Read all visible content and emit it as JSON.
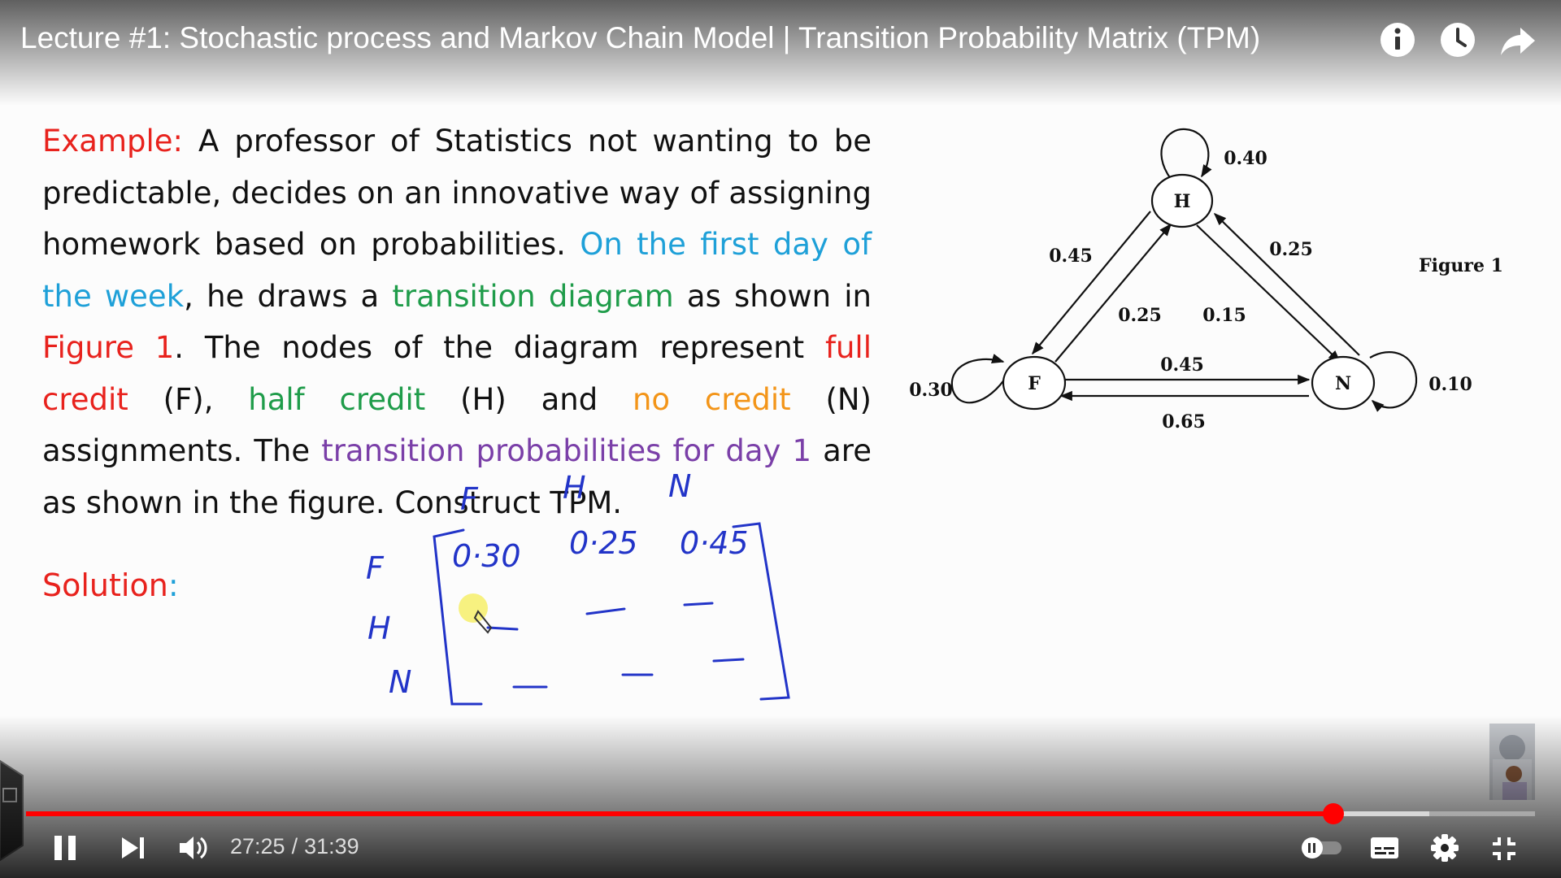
{
  "video": {
    "title": "Lecture #1: Stochastic process and Markov Chain Model | Transition Probability Matrix (TPM)"
  },
  "top_icons": [
    "info-icon",
    "clock-icon",
    "share-icon"
  ],
  "slide": {
    "paragraph": [
      {
        "text": "Example:",
        "color": "red"
      },
      {
        "text": " A professor of Statistics not wanting to be predictable, decides on an innovative way of assigning homework based on probabilities. ",
        "color": "black"
      },
      {
        "text": "On the first day of the week",
        "color": "blue"
      },
      {
        "text": ", he draws a ",
        "color": "black"
      },
      {
        "text": "transition diagram",
        "color": "green"
      },
      {
        "text": " as shown in ",
        "color": "black"
      },
      {
        "text": "Figure 1",
        "color": "red"
      },
      {
        "text": ". The nodes of the diagram represent ",
        "color": "black"
      },
      {
        "text": "full credit",
        "color": "red"
      },
      {
        "text": " (F), ",
        "color": "black"
      },
      {
        "text": "half credit",
        "color": "green"
      },
      {
        "text": " (H) and ",
        "color": "black"
      },
      {
        "text": "no credit",
        "color": "orange"
      },
      {
        "text": " (N) assignments. The ",
        "color": "black"
      },
      {
        "text": "transition probabilities for day 1",
        "color": "purple"
      },
      {
        "text": " are as shown in the figure. Construct TPM.",
        "color": "black"
      }
    ],
    "solution_label": "Solution",
    "solution_colon": ":"
  },
  "diagram": {
    "figure_label": "Figure 1",
    "nodes": {
      "H": "H",
      "F": "F",
      "N": "N"
    },
    "labels": {
      "h_self": "0.40",
      "f_self": "0.30",
      "n_self": "0.10",
      "f_to_h_outer": "0.45",
      "f_to_h_inner": "0.25",
      "h_to_n_outer": "0.25",
      "h_to_n_inner": "0.15",
      "f_to_n": "0.45",
      "n_to_f": "0.65"
    }
  },
  "matrix": {
    "col_headers": [
      "F",
      "H",
      "N"
    ],
    "row_headers": [
      "F",
      "H",
      "N"
    ],
    "row_f": [
      "0·30",
      "0·25",
      "0·45"
    ]
  },
  "player": {
    "current_time": "27:25",
    "separator": "/",
    "duration": "31:39",
    "progress_fraction": 0.8662,
    "buffer_fraction": 0.93,
    "colors": {
      "accent": "#ff0000",
      "text": "#dddddd"
    },
    "controls": [
      "pause-icon",
      "next-icon",
      "volume-icon",
      "autoplay-toggle",
      "subtitles-icon",
      "settings-icon",
      "exit-fullscreen-icon"
    ]
  }
}
